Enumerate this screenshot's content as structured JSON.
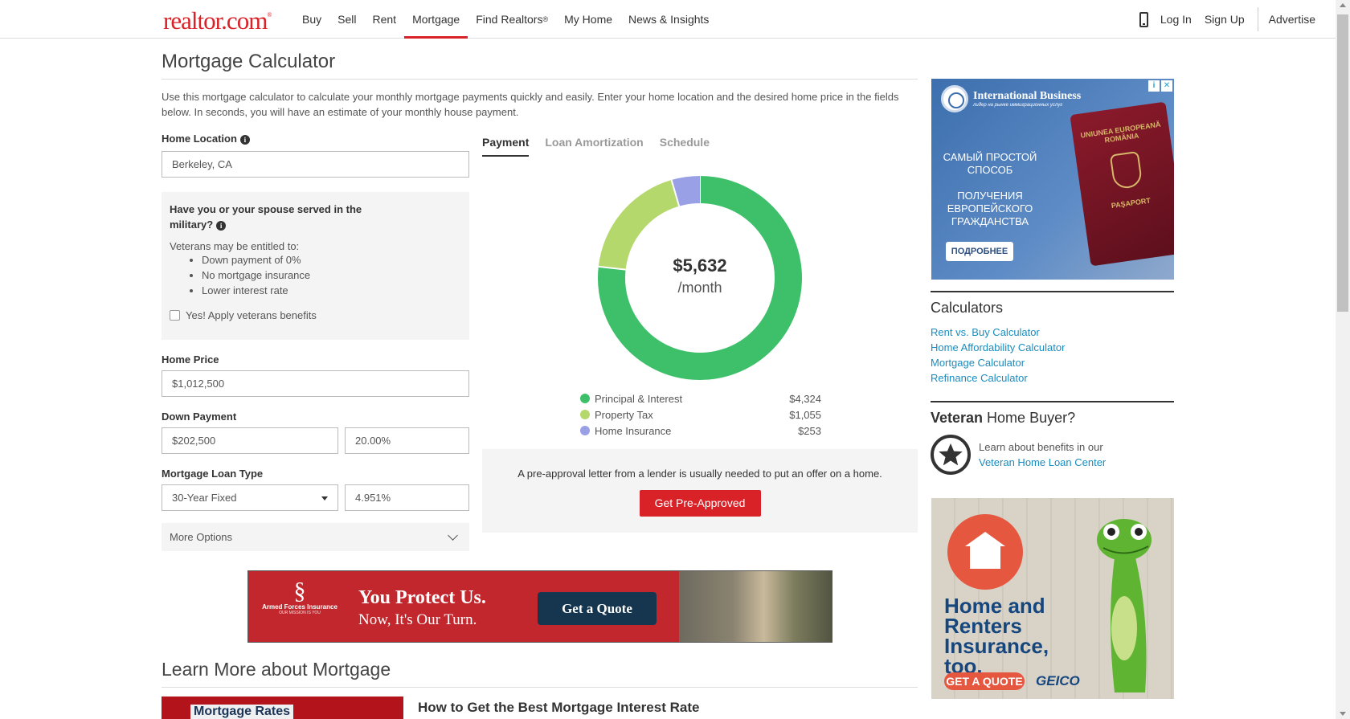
{
  "header": {
    "logo": "realtor.com",
    "logo_mark": "®",
    "nav": [
      "Buy",
      "Sell",
      "Rent",
      "Mortgage",
      "Find Realtors",
      "My Home",
      "News & Insights"
    ],
    "nav_sup": "®",
    "active_nav": "Mortgage",
    "login": "Log In",
    "signup": "Sign Up",
    "advertise": "Advertise"
  },
  "page": {
    "title": "Mortgage Calculator",
    "intro": "Use this mortgage calculator to calculate your monthly mortgage payments quickly and easily. Enter your home location and the desired home price in the fields below. In seconds, you will have an estimate of your monthly house payment."
  },
  "form": {
    "home_location_label": "Home Location",
    "home_location_value": "Berkeley, CA",
    "military": {
      "question": "Have you or your spouse served in the military?",
      "entitled": "Veterans may be entitled to:",
      "benefits": [
        "Down payment of 0%",
        "No mortgage insurance",
        "Lower interest rate"
      ],
      "checkbox_label": "Yes! Apply veterans benefits"
    },
    "home_price_label": "Home Price",
    "home_price_value": "$1,012,500",
    "down_payment_label": "Down Payment",
    "down_payment_value": "$202,500",
    "down_payment_percent": "20.00%",
    "loan_type_label": "Mortgage Loan Type",
    "loan_type_value": "30-Year Fixed",
    "interest_rate": "4.951%",
    "more_options": "More Options"
  },
  "tabs": [
    "Payment",
    "Loan Amortization",
    "Schedule"
  ],
  "summary": {
    "amount": "$5,632",
    "period": "/month"
  },
  "chart_data": {
    "type": "pie",
    "categories": [
      "Principal & Interest",
      "Property Tax",
      "Home Insurance"
    ],
    "values": [
      4324,
      1055,
      253
    ],
    "value_labels": [
      "$4,324",
      "$1,055",
      "$253"
    ],
    "colors": [
      "#3ec06b",
      "#b4d86c",
      "#9aa0e6"
    ]
  },
  "preapproval": {
    "text": "A pre-approval letter from a lender is usually needed to put an offer on a home.",
    "button": "Get Pre-Approved"
  },
  "banner_ad": {
    "brand": "Armed Forces Insurance",
    "brand_tag": "OUR MISSION IS YOU",
    "headline": "You Protect Us.",
    "subline": "Now, It's Our Turn.",
    "button": "Get a Quote"
  },
  "learn": {
    "title": "Learn More about Mortgage",
    "thumb_text": "Mortgage Rates",
    "article_title": "How to Get the Best Mortgage Interest Rate"
  },
  "ad_top": {
    "brand": "International Business",
    "brand_sub": "лидер на рынке иммиграционных услуг",
    "text": "САМЫЙ ПРОСТОЙ СПОСОБ\n\nПОЛУЧЕНИЯ ЕВРОПЕЙСКОГО ГРАЖДАНСТВА",
    "button": "ПОДРОБНЕЕ",
    "passport_top": "UNIUNEA EUROPEANĂ ROMÂNIA",
    "passport_bottom": "PAŞAPORT"
  },
  "sidebar": {
    "calculators_title": "Calculators",
    "calculator_links": [
      "Rent vs. Buy Calculator",
      "Home Affordability Calculator",
      "Mortgage Calculator",
      "Refinance Calculator"
    ],
    "veteran_title_bold": "Veteran",
    "veteran_title_rest": " Home Buyer?",
    "veteran_text": "Learn about benefits in our",
    "veteran_link": "Veteran Home Loan Center"
  },
  "ad_geico": {
    "headline": "Home and Renters Insurance, too.",
    "button": "GET A QUOTE",
    "logo": "GEICO"
  }
}
